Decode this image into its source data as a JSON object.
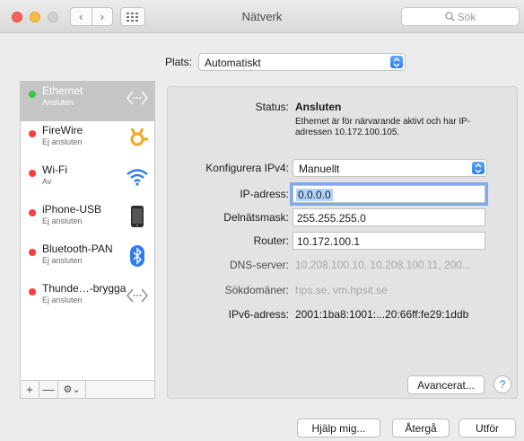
{
  "window": {
    "title": "Nätverk"
  },
  "toolbar": {
    "back_glyph": "‹",
    "forward_glyph": "›",
    "search_placeholder": "Sök"
  },
  "location": {
    "label": "Plats:",
    "value": "Automatiskt"
  },
  "services": [
    {
      "name": "Ethernet",
      "status": "Ansluten",
      "dot": "#34c84a",
      "icon": "ethernet-icon",
      "selected": true
    },
    {
      "name": "FireWire",
      "status": "Ej ansluten",
      "dot": "#fc3d39",
      "icon": "firewire-icon"
    },
    {
      "name": "Wi-Fi",
      "status": "Av",
      "dot": "#fc3d39",
      "icon": "wifi-icon"
    },
    {
      "name": "iPhone-USB",
      "status": "Ej ansluten",
      "dot": "#fc3d39",
      "icon": "iphone-icon"
    },
    {
      "name": "Bluetooth-PAN",
      "status": "Ej ansluten",
      "dot": "#fc3d39",
      "icon": "bluetooth-icon"
    },
    {
      "name": "Thunde…-brygga",
      "status": "Ej ansluten",
      "dot": "#fc3d39",
      "icon": "thunderbolt-bridge-icon"
    }
  ],
  "sidebar_toolbar": {
    "add": "+",
    "remove": "—",
    "action": "⚙︎⌄"
  },
  "detail": {
    "status_label": "Status:",
    "status_value": "Ansluten",
    "status_desc_1": "Ethernet är för närvarande aktivt och har IP-",
    "status_desc_2": "adressen 10.172.100.105.",
    "config_label": "Konfigurera IPv4:",
    "config_value": "Manuellt",
    "ip_label": "IP-adress:",
    "ip_value": "0.0.0.0",
    "subnet_label": "Delnätsmask:",
    "subnet_value": "255.255.255.0",
    "router_label": "Router:",
    "router_value": "10.172.100.1",
    "dns_label": "DNS-server:",
    "dns_value": "10.208.100.10, 10.208.100.11, 200...",
    "search_domains_label": "Sökdomäner:",
    "search_domains_value": "hps.se, vm.hpsit.se",
    "ipv6_label": "IPv6-adress:",
    "ipv6_value": "2001:1ba8:1001:...20:66ff:fe29:1ddb"
  },
  "buttons": {
    "advanced": "Avancerat...",
    "help_q": "?",
    "assist": "Hjälp mig...",
    "revert": "Återgå",
    "apply": "Utför"
  },
  "colors": {
    "accent": "#2f7cf1",
    "status_connected": "#34c84a",
    "status_off": "#fc3d39"
  }
}
